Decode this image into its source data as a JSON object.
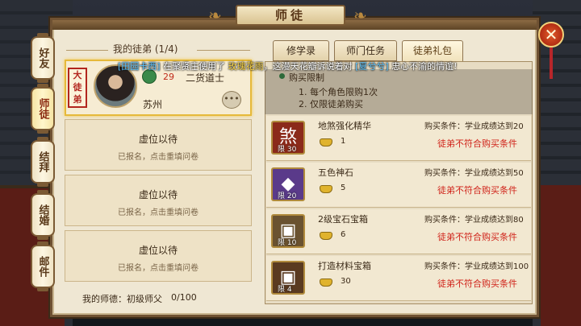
{
  "window": {
    "title": "师徒",
    "close_symbol": "✕"
  },
  "side_tabs": [
    {
      "label": "好友",
      "active": false
    },
    {
      "label": "师徒",
      "active": true
    },
    {
      "label": "结拜",
      "active": false
    },
    {
      "label": "结婚",
      "active": false
    },
    {
      "label": "邮件",
      "active": false
    }
  ],
  "disciples": {
    "header": "我的徒弟 (1/4)",
    "main": {
      "seal": "大徒弟",
      "level": "29",
      "name": "二货道士",
      "city": "苏州",
      "more": "•••"
    },
    "empty_slots": [
      {
        "title": "虚位以待",
        "hint": "已报名，点击重填问卷"
      },
      {
        "title": "虚位以待",
        "hint": "已报名，点击重填问卷"
      },
      {
        "title": "虚位以待",
        "hint": "已报名，点击重填问卷"
      }
    ],
    "virtue_label": "我的师德：初级师父",
    "virtue_progress": "0/100"
  },
  "tabs": [
    {
      "label": "修学录",
      "active": false
    },
    {
      "label": "师门任务",
      "active": false
    },
    {
      "label": "徒弟礼包",
      "active": true
    }
  ],
  "rules": {
    "head": "购买限制",
    "items": [
      "1. 每个角色限购1次",
      "2. 仅限徒弟购买"
    ]
  },
  "items": [
    {
      "name": "地煞强化精华",
      "condition": "购买条件：学业成绩达到20",
      "limit": "限 30",
      "price": "1",
      "status": "徒弟不符合购买条件",
      "icon": "煞",
      "icon_color": "#8b2a1a"
    },
    {
      "name": "五色神石",
      "condition": "购买条件：学业成绩达到50",
      "limit": "限 20",
      "price": "5",
      "status": "徒弟不符合购买条件",
      "icon": "◆",
      "icon_color": "#5a3a8a"
    },
    {
      "name": "2级宝石宝箱",
      "condition": "购买条件：学业成绩达到80",
      "limit": "限 10",
      "price": "6",
      "status": "徒弟不符合购买条件",
      "icon": "▣",
      "icon_color": "#6a5230"
    },
    {
      "name": "打造材料宝箱",
      "condition": "购买条件：学业成绩达到100",
      "limit": "限 4",
      "price": "30",
      "status": "徒弟不符合购买条件",
      "icon": "▣",
      "icon_color": "#5a3a20"
    }
  ],
  "broadcast": {
    "player": "[田园卡西]",
    "p1": " 在聚贤庄使用了 ",
    "item": "玫瑰花雨",
    "p2": "，这漫天花瓣诉说着对 ",
    "target": "[夏兮兮]",
    "p3": " 忠心不渝的情谊!"
  }
}
